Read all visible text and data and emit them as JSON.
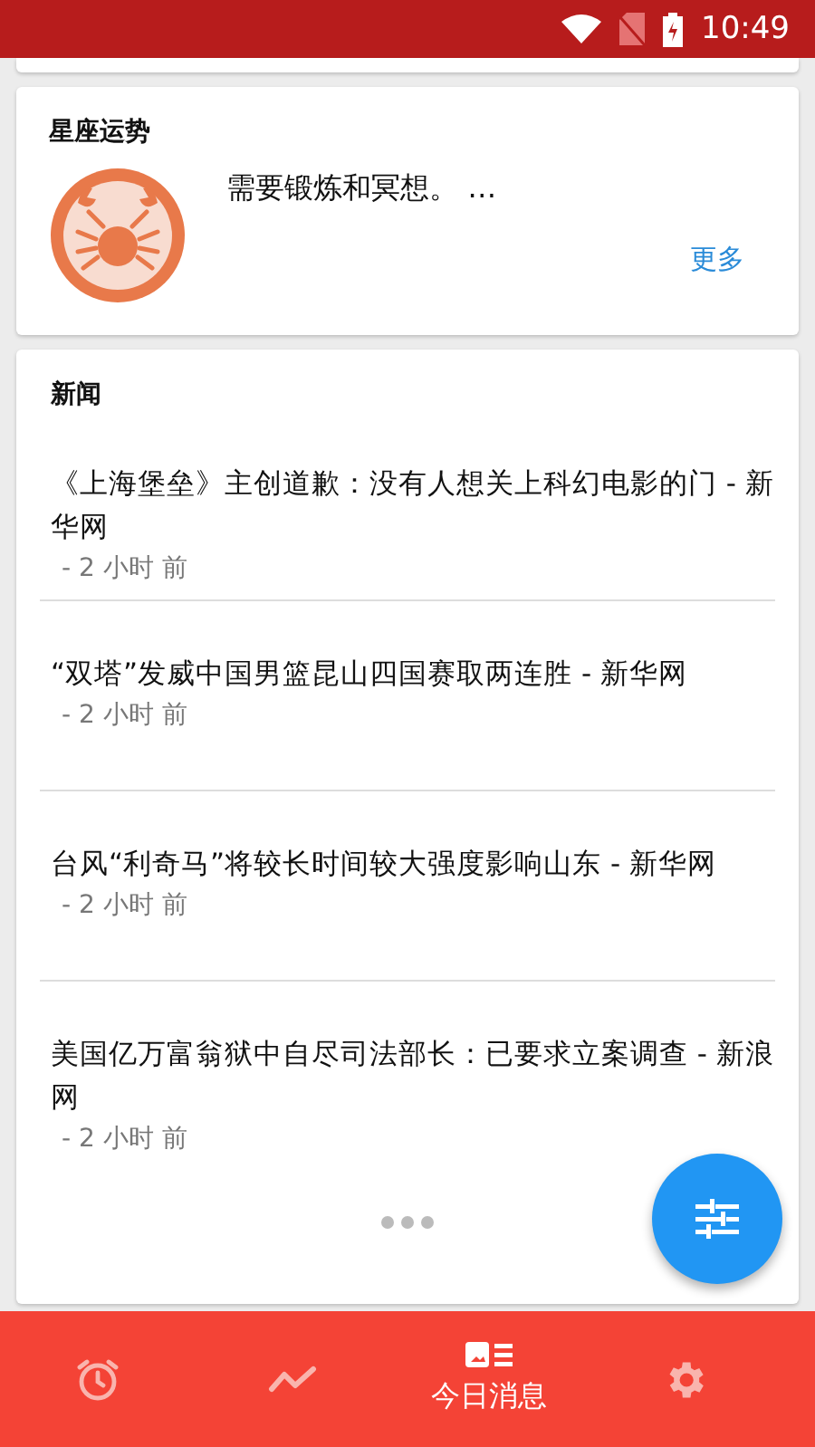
{
  "status_bar": {
    "time": "10:49"
  },
  "horoscope": {
    "title": "星座运势",
    "text": "需要锻炼和冥想。 …",
    "more": "更多"
  },
  "news": {
    "title": "新闻",
    "items": [
      {
        "title": "《上海堡垒》主创道歉：没有人想关上科幻电影的门 - 新华网",
        "time": "- 2 小时 前"
      },
      {
        "title": "“双塔”发威中国男篮昆山四国赛取两连胜 - 新华网",
        "time": "- 2 小时 前"
      },
      {
        "title": "台风“利奇马”将较长时间较大强度影响山东 - 新华网",
        "time": "- 2 小时 前"
      },
      {
        "title": "美国亿万富翁狱中自尽司法部长：已要求立案调查 - 新浪网",
        "time": "- 2 小时 前"
      }
    ]
  },
  "bottom_nav": [
    {
      "kind": "alarm",
      "selected": false
    },
    {
      "kind": "trend",
      "selected": false
    },
    {
      "kind": "news",
      "label": "今日消息",
      "selected": true
    },
    {
      "kind": "settings",
      "selected": false
    }
  ]
}
